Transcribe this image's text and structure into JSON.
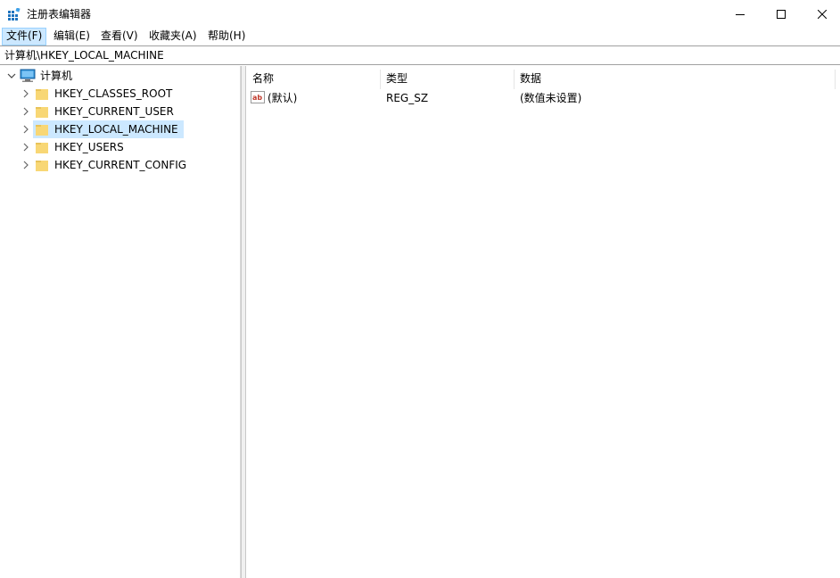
{
  "window": {
    "title": "注册表编辑器"
  },
  "menu": [
    {
      "label": "文件(F)",
      "active": true
    },
    {
      "label": "编辑(E)",
      "active": false
    },
    {
      "label": "查看(V)",
      "active": false
    },
    {
      "label": "收藏夹(A)",
      "active": false
    },
    {
      "label": "帮助(H)",
      "active": false
    }
  ],
  "address": {
    "path": "计算机\\HKEY_LOCAL_MACHINE"
  },
  "tree": {
    "root_label": "计算机",
    "items": [
      {
        "label": "HKEY_CLASSES_ROOT",
        "selected": false
      },
      {
        "label": "HKEY_CURRENT_USER",
        "selected": false
      },
      {
        "label": "HKEY_LOCAL_MACHINE",
        "selected": true
      },
      {
        "label": "HKEY_USERS",
        "selected": false
      },
      {
        "label": "HKEY_CURRENT_CONFIG",
        "selected": false
      }
    ]
  },
  "list": {
    "columns": [
      "名称",
      "类型",
      "数据"
    ],
    "rows": [
      {
        "name": "(默认)",
        "type": "REG_SZ",
        "data": "(数值未设置)",
        "icon": "string-value-icon"
      }
    ]
  },
  "colors": {
    "selection": "#cce8ff",
    "folder": "#f8d775",
    "string_icon": "#c0392b"
  }
}
